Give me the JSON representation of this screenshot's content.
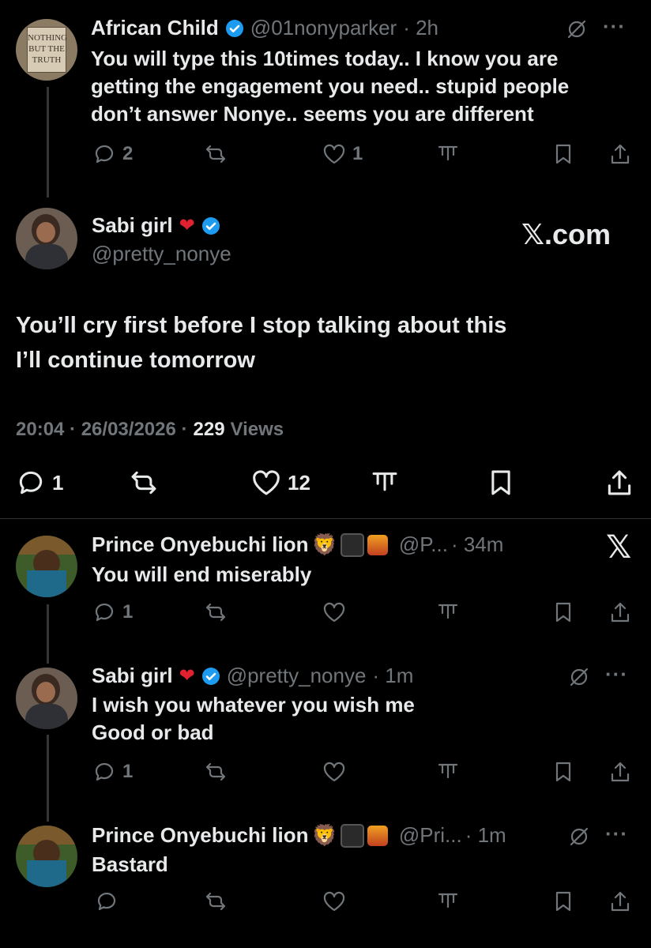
{
  "tweets": [
    {
      "name": "African Child",
      "handle": "@01nonyparker",
      "time": "· 2h",
      "avatar_text": [
        "NOTHING",
        "BUT THE",
        "TRUTH"
      ],
      "lines": [
        "You will type this 10times today.. I know you are",
        "getting the engagement you need.. stupid people",
        "don’t answer Nonye.. seems you are different"
      ],
      "replies": "2",
      "reposts": "",
      "likes": "1"
    },
    {
      "name": "Prince Onyebuchi lion",
      "handle": "@P...",
      "time": "· 34m",
      "lines": [
        "You will end miserably"
      ],
      "replies": "1",
      "reposts": "",
      "likes": ""
    },
    {
      "name": "Sabi girl",
      "handle": "@pretty_nonye",
      "time": "· 1m",
      "lines": [
        "I wish you whatever you wish me",
        "Good or bad"
      ],
      "replies": "1",
      "reposts": "",
      "likes": ""
    },
    {
      "name": "Prince Onyebuchi lion",
      "handle": "@Pri...",
      "time": "· 1m",
      "lines": [
        "Bastard"
      ],
      "replies": "",
      "reposts": "",
      "likes": ""
    }
  ],
  "main": {
    "name": "Sabi girl",
    "handle": "@pretty_nonye",
    "watermark": "𝕏.com",
    "lines": [
      "You’ll cry first before I stop talking about this",
      "I’ll continue tomorrow"
    ],
    "time": "20:04 · 26/03/2026 ·",
    "views_count": "229",
    "views_label": "Views",
    "replies": "1",
    "likes": "12"
  },
  "x_logo": "𝕏",
  "more_label": "···",
  "colors": {
    "verified": "#1d9bf0",
    "background": "#000000",
    "muted": "#71767b"
  }
}
